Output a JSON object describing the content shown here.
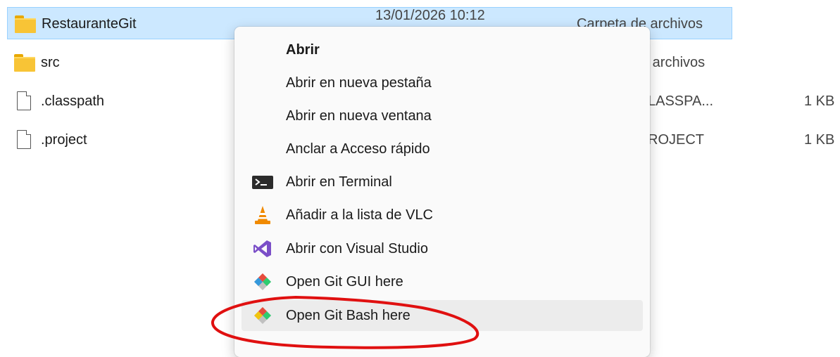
{
  "files": [
    {
      "name": "RestauranteGit",
      "date": "13/01/2026 10:12",
      "type": "Carpeta de archivos",
      "size": "",
      "icon": "folder-icon",
      "selected": true
    },
    {
      "name": "src",
      "date": "",
      "type": "e archivos",
      "size": "",
      "icon": "folder-icon",
      "selected": false
    },
    {
      "name": ".classpath",
      "date": "",
      "type": "LASSPA...",
      "size": "1 KB",
      "icon": "document-icon",
      "selected": false
    },
    {
      "name": ".project",
      "date": "",
      "type": "ROJECT",
      "size": "1 KB",
      "icon": "document-icon",
      "selected": false
    }
  ],
  "context_menu": {
    "items": [
      {
        "label": "Abrir",
        "bold": true,
        "icon": ""
      },
      {
        "label": "Abrir en nueva pestaña",
        "bold": false,
        "icon": ""
      },
      {
        "label": "Abrir en nueva ventana",
        "bold": false,
        "icon": ""
      },
      {
        "label": "Anclar a Acceso rápido",
        "bold": false,
        "icon": ""
      },
      {
        "label": "Abrir en Terminal",
        "bold": false,
        "icon": "terminal-icon"
      },
      {
        "label": "Añadir a la lista de VLC",
        "bold": false,
        "icon": "vlc-cone-icon"
      },
      {
        "label": "Abrir con Visual Studio",
        "bold": false,
        "icon": "visual-studio-icon"
      },
      {
        "label": "Open Git GUI here",
        "bold": false,
        "icon": "git-icon"
      },
      {
        "label": "Open Git Bash here",
        "bold": false,
        "icon": "git-icon",
        "hovered": true
      }
    ]
  },
  "colors": {
    "selection": "#cce8ff",
    "annotation": "#e01010",
    "menu_background": "#fafafa"
  }
}
